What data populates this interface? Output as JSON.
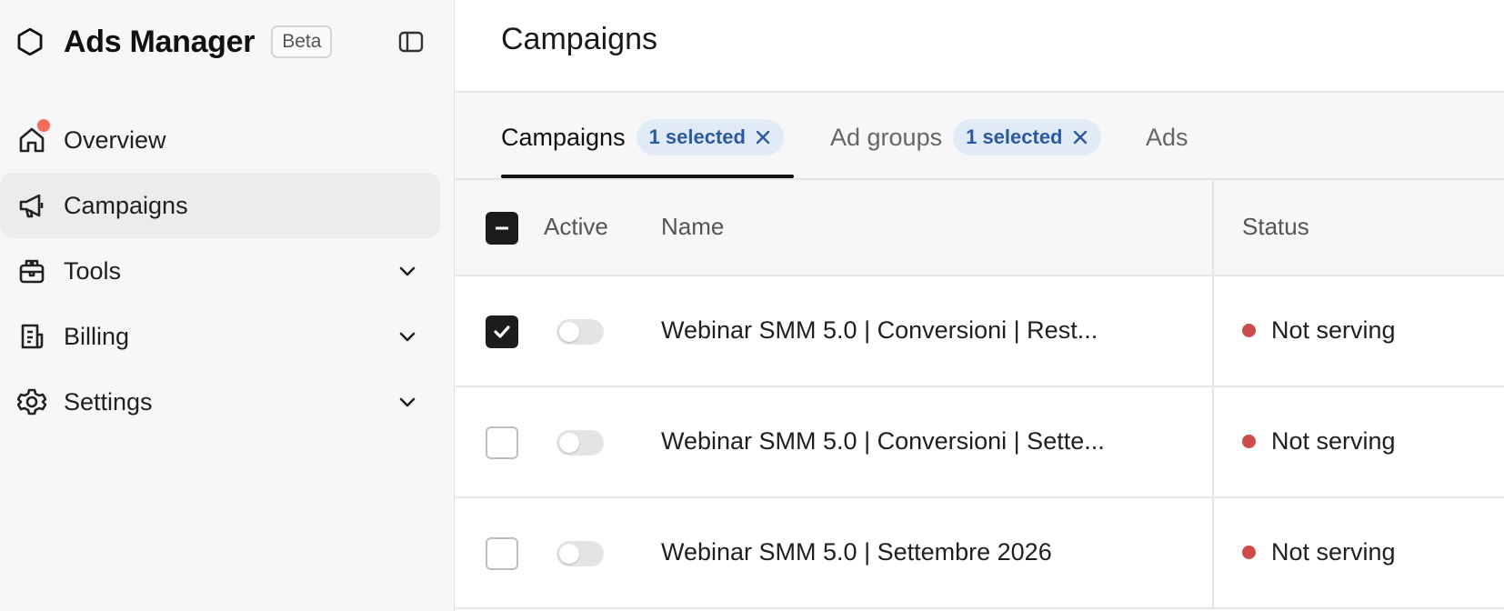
{
  "sidebar": {
    "brand_title": "Ads Manager",
    "beta_label": "Beta",
    "items": [
      {
        "label": "Overview",
        "icon": "home-icon",
        "has_notification": true
      },
      {
        "label": "Campaigns",
        "icon": "megaphone-icon",
        "active": true
      },
      {
        "label": "Tools",
        "icon": "toolbox-icon",
        "expandable": true
      },
      {
        "label": "Billing",
        "icon": "receipt-icon",
        "expandable": true
      },
      {
        "label": "Settings",
        "icon": "gear-icon",
        "expandable": true
      }
    ]
  },
  "main": {
    "page_title": "Campaigns",
    "tabs": [
      {
        "label": "Campaigns",
        "chip": "1 selected",
        "active": true
      },
      {
        "label": "Ad groups",
        "chip": "1 selected"
      },
      {
        "label": "Ads"
      }
    ],
    "table": {
      "headers": {
        "active": "Active",
        "name": "Name",
        "status": "Status"
      },
      "rows": [
        {
          "name": "Webinar SMM 5.0 | Conversioni | Rest...",
          "status": "Not serving",
          "checked": true,
          "active": false
        },
        {
          "name": "Webinar SMM 5.0 | Conversioni | Sette...",
          "status": "Not serving",
          "checked": false,
          "active": false
        },
        {
          "name": "Webinar SMM 5.0 | Settembre 2026",
          "status": "Not serving",
          "checked": false,
          "active": false
        }
      ]
    }
  },
  "colors": {
    "accent_chip_bg": "#e1ebf8",
    "accent_chip_text": "#2c5aa0",
    "status_not_serving": "#cc4b4b",
    "notification": "#f26b5b"
  }
}
